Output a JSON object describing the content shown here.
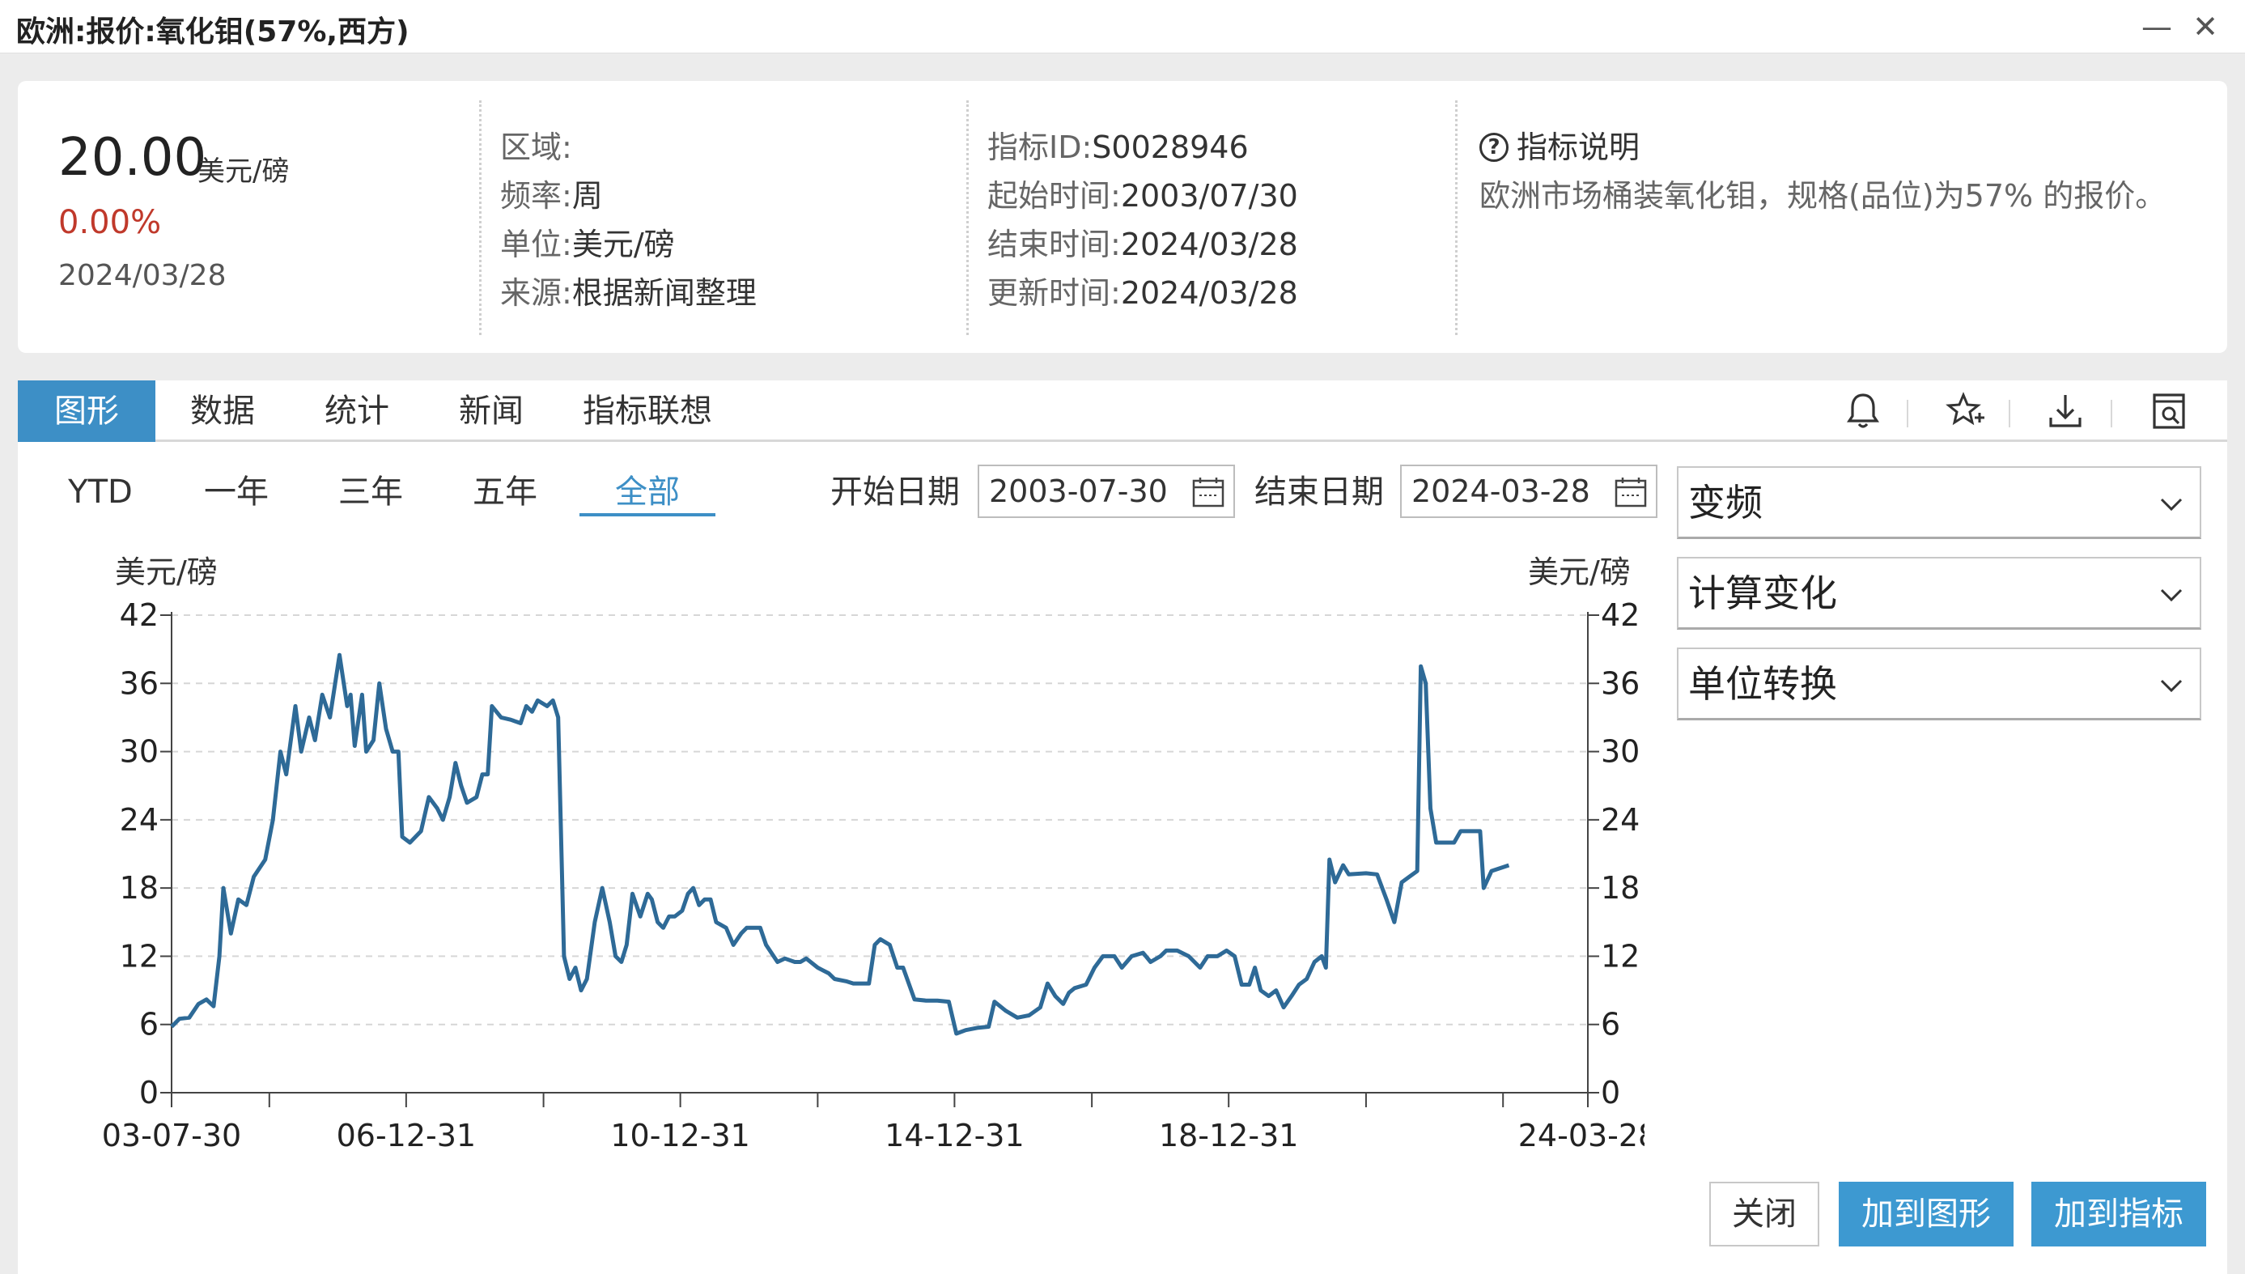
{
  "window": {
    "title": "欧洲:报价:氧化钼(57%,西方)",
    "minimize_glyph": "—",
    "close_glyph": "✕"
  },
  "summary": {
    "price": "20.00",
    "unit": "美元/磅",
    "change": "0.00%",
    "change_color": "#c0392b",
    "date": "2024/03/28"
  },
  "meta_left": [
    {
      "key": "区域:",
      "value": ""
    },
    {
      "key": "频率:",
      "value": "周"
    },
    {
      "key": "单位:",
      "value": "美元/磅"
    },
    {
      "key": "来源:",
      "value": "根据新闻整理"
    }
  ],
  "meta_right": [
    {
      "key": "指标ID:",
      "value": "S0028946"
    },
    {
      "key": "起始时间:",
      "value": "2003/07/30"
    },
    {
      "key": "结束时间:",
      "value": "2024/03/28"
    },
    {
      "key": "更新时间:",
      "value": "2024/03/28"
    }
  ],
  "help": {
    "icon": "?",
    "title": "指标说明",
    "description": "欧洲市场桶装氧化钼，规格(品位)为57% 的报价。"
  },
  "tabs": [
    "图形",
    "数据",
    "统计",
    "新闻",
    "指标联想"
  ],
  "active_tab": "图形",
  "toolbar_icons": [
    "bell-icon",
    "star-add-icon",
    "download-icon",
    "preview-icon"
  ],
  "ranges": [
    "YTD",
    "一年",
    "三年",
    "五年",
    "全部"
  ],
  "active_range": "全部",
  "date_filter": {
    "start_label": "开始日期",
    "start_value": "2003-07-30",
    "end_label": "结束日期",
    "end_value": "2024-03-28"
  },
  "dropdowns": [
    "变频",
    "计算变化",
    "单位转换"
  ],
  "buttons": {
    "close": "关闭",
    "add_to_chart": "加到图形",
    "add_to_indicator": "加到指标"
  },
  "accent_color": "#3d8fc6",
  "chart_data": {
    "type": "line",
    "title": "",
    "y_left_label": "美元/磅",
    "y_right_label": "美元/磅",
    "ylim": [
      0,
      42
    ],
    "y_ticks": [
      "0",
      "6",
      "12",
      "18",
      "24",
      "30",
      "36",
      "42"
    ],
    "x_range": [
      "2003-07-30",
      "2024-03-28"
    ],
    "x_tick_labels": [
      {
        "date": "2003-07-30",
        "label": "03-07-30"
      },
      {
        "date": "2006-12-31",
        "label": "06-12-31"
      },
      {
        "date": "2010-12-31",
        "label": "10-12-31"
      },
      {
        "date": "2014-12-31",
        "label": "14-12-31"
      },
      {
        "date": "2018-12-31",
        "label": "18-12-31"
      },
      {
        "date": "2024-03-28",
        "label": "24-03-28"
      }
    ],
    "x_minor_ticks": [
      "2005-01-01",
      "2009-01-01",
      "2013-01-01",
      "2017-01-01",
      "2021-01-01",
      "2023-01-01"
    ],
    "grid": "horizontal-dashed",
    "series": [
      {
        "color": "#2e6a97",
        "points": [
          [
            "2003-07-30",
            5.8
          ],
          [
            "2003-09-10",
            6.5
          ],
          [
            "2003-11-01",
            6.6
          ],
          [
            "2003-12-20",
            7.8
          ],
          [
            "2004-02-01",
            8.2
          ],
          [
            "2004-03-10",
            7.6
          ],
          [
            "2004-04-10",
            12
          ],
          [
            "2004-05-01",
            18
          ],
          [
            "2004-06-10",
            14
          ],
          [
            "2004-07-20",
            17
          ],
          [
            "2004-09-01",
            16.5
          ],
          [
            "2004-10-10",
            19
          ],
          [
            "2004-12-10",
            20.5
          ],
          [
            "2005-01-20",
            24
          ],
          [
            "2005-03-01",
            30
          ],
          [
            "2005-04-01",
            28
          ],
          [
            "2005-05-20",
            34
          ],
          [
            "2005-06-20",
            30
          ],
          [
            "2005-08-01",
            33
          ],
          [
            "2005-09-01",
            31
          ],
          [
            "2005-10-10",
            35
          ],
          [
            "2005-11-20",
            33
          ],
          [
            "2006-01-10",
            38.5
          ],
          [
            "2006-02-20",
            34
          ],
          [
            "2006-03-10",
            35
          ],
          [
            "2006-04-01",
            30.5
          ],
          [
            "2006-05-10",
            35
          ],
          [
            "2006-06-01",
            30
          ],
          [
            "2006-07-10",
            31
          ],
          [
            "2006-08-10",
            36
          ],
          [
            "2006-09-15",
            32
          ],
          [
            "2006-10-20",
            30
          ],
          [
            "2006-11-20",
            30
          ],
          [
            "2006-12-10",
            22.5
          ],
          [
            "2007-01-20",
            22
          ],
          [
            "2007-03-20",
            23
          ],
          [
            "2007-05-01",
            26
          ],
          [
            "2007-06-15",
            25
          ],
          [
            "2007-07-15",
            24
          ],
          [
            "2007-08-20",
            26
          ],
          [
            "2007-09-20",
            29
          ],
          [
            "2007-10-20",
            27
          ],
          [
            "2007-11-20",
            25.5
          ],
          [
            "2008-01-10",
            26
          ],
          [
            "2008-02-10",
            28
          ],
          [
            "2008-03-10",
            28
          ],
          [
            "2008-04-01",
            34
          ],
          [
            "2008-05-20",
            33
          ],
          [
            "2008-07-10",
            32.8
          ],
          [
            "2008-09-01",
            32.5
          ],
          [
            "2008-10-01",
            34
          ],
          [
            "2008-11-01",
            33.5
          ],
          [
            "2008-12-01",
            34.5
          ],
          [
            "2009-01-20",
            34
          ],
          [
            "2009-02-20",
            34.5
          ],
          [
            "2009-03-20",
            33
          ],
          [
            "2009-04-20",
            12
          ],
          [
            "2009-05-20",
            10
          ],
          [
            "2009-06-20",
            11
          ],
          [
            "2009-07-20",
            9
          ],
          [
            "2009-08-20",
            10
          ],
          [
            "2009-10-01",
            15
          ],
          [
            "2009-11-10",
            18
          ],
          [
            "2009-12-20",
            15
          ],
          [
            "2010-01-20",
            12
          ],
          [
            "2010-02-20",
            11.5
          ],
          [
            "2010-03-20",
            13
          ],
          [
            "2010-04-20",
            17.5
          ],
          [
            "2010-06-01",
            15.5
          ],
          [
            "2010-07-10",
            17.5
          ],
          [
            "2010-08-01",
            17
          ],
          [
            "2010-09-01",
            15
          ],
          [
            "2010-10-01",
            14.5
          ],
          [
            "2010-11-01",
            15.5
          ],
          [
            "2010-12-01",
            15.5
          ],
          [
            "2011-01-10",
            16
          ],
          [
            "2011-02-10",
            17.5
          ],
          [
            "2011-03-10",
            18
          ],
          [
            "2011-04-10",
            16.5
          ],
          [
            "2011-05-10",
            17
          ],
          [
            "2011-06-10",
            17
          ],
          [
            "2011-07-10",
            15
          ],
          [
            "2011-09-01",
            14.5
          ],
          [
            "2011-10-10",
            13
          ],
          [
            "2011-11-20",
            14
          ],
          [
            "2011-12-20",
            14.5
          ],
          [
            "2012-02-01",
            14.5
          ],
          [
            "2012-03-01",
            14.5
          ],
          [
            "2012-04-01",
            13
          ],
          [
            "2012-06-01",
            11.5
          ],
          [
            "2012-07-10",
            11.8
          ],
          [
            "2012-09-01",
            11.5
          ],
          [
            "2012-10-01",
            11.5
          ],
          [
            "2012-11-01",
            11.8
          ],
          [
            "2013-01-01",
            11
          ],
          [
            "2013-03-01",
            10.5
          ],
          [
            "2013-04-01",
            10
          ],
          [
            "2013-06-01",
            9.8
          ],
          [
            "2013-07-10",
            9.6
          ],
          [
            "2013-09-01",
            9.6
          ],
          [
            "2013-10-01",
            9.6
          ],
          [
            "2013-11-01",
            13
          ],
          [
            "2013-12-01",
            13.5
          ],
          [
            "2014-01-20",
            13
          ],
          [
            "2014-03-01",
            11
          ],
          [
            "2014-04-01",
            11
          ],
          [
            "2014-06-01",
            8.2
          ],
          [
            "2014-08-01",
            8.1
          ],
          [
            "2014-10-01",
            8.1
          ],
          [
            "2014-12-01",
            8
          ],
          [
            "2015-01-10",
            5.2
          ],
          [
            "2015-03-01",
            5.5
          ],
          [
            "2015-05-01",
            5.7
          ],
          [
            "2015-07-01",
            5.8
          ],
          [
            "2015-08-01",
            8
          ],
          [
            "2015-10-01",
            7.2
          ],
          [
            "2015-12-01",
            6.6
          ],
          [
            "2016-02-01",
            6.8
          ],
          [
            "2016-04-01",
            7.5
          ],
          [
            "2016-05-10",
            9.6
          ],
          [
            "2016-06-20",
            8.5
          ],
          [
            "2016-08-01",
            7.8
          ],
          [
            "2016-09-01",
            8.8
          ],
          [
            "2016-10-01",
            9.2
          ],
          [
            "2016-12-01",
            9.5
          ],
          [
            "2017-01-15",
            11
          ],
          [
            "2017-03-01",
            12
          ],
          [
            "2017-05-01",
            12
          ],
          [
            "2017-06-10",
            11
          ],
          [
            "2017-08-01",
            12
          ],
          [
            "2017-10-01",
            12.3
          ],
          [
            "2017-11-10",
            11.5
          ],
          [
            "2018-01-01",
            12
          ],
          [
            "2018-02-01",
            12.5
          ],
          [
            "2018-04-01",
            12.5
          ],
          [
            "2018-06-01",
            12
          ],
          [
            "2018-08-01",
            11
          ],
          [
            "2018-09-10",
            12
          ],
          [
            "2018-11-01",
            12
          ],
          [
            "2018-12-20",
            12.5
          ],
          [
            "2019-02-01",
            12
          ],
          [
            "2019-03-10",
            9.5
          ],
          [
            "2019-04-20",
            9.5
          ],
          [
            "2019-05-20",
            11
          ],
          [
            "2019-06-20",
            9
          ],
          [
            "2019-08-01",
            8.5
          ],
          [
            "2019-09-10",
            9
          ],
          [
            "2019-10-20",
            7.5
          ],
          [
            "2019-12-01",
            8.5
          ],
          [
            "2020-01-10",
            9.5
          ],
          [
            "2020-02-20",
            10
          ],
          [
            "2020-04-01",
            11.5
          ],
          [
            "2020-05-10",
            12
          ],
          [
            "2020-06-01",
            11
          ],
          [
            "2020-06-20",
            20.5
          ],
          [
            "2020-07-20",
            18.5
          ],
          [
            "2020-09-01",
            20
          ],
          [
            "2020-10-01",
            19.2
          ],
          [
            "2021-01-01",
            19.3
          ],
          [
            "2021-03-01",
            19.2
          ],
          [
            "2021-04-20",
            17
          ],
          [
            "2021-06-01",
            15
          ],
          [
            "2021-07-10",
            18.5
          ],
          [
            "2021-08-20",
            19
          ],
          [
            "2021-10-01",
            19.5
          ],
          [
            "2021-10-20",
            37.5
          ],
          [
            "2021-11-15",
            36
          ],
          [
            "2021-12-10",
            25
          ],
          [
            "2022-01-10",
            22
          ],
          [
            "2022-03-01",
            22
          ],
          [
            "2022-04-15",
            22
          ],
          [
            "2022-05-20",
            23
          ],
          [
            "2022-07-01",
            23
          ],
          [
            "2022-09-01",
            23
          ],
          [
            "2022-09-20",
            18
          ],
          [
            "2022-11-01",
            19.5
          ],
          [
            "2023-02-01",
            20
          ]
        ]
      }
    ]
  }
}
